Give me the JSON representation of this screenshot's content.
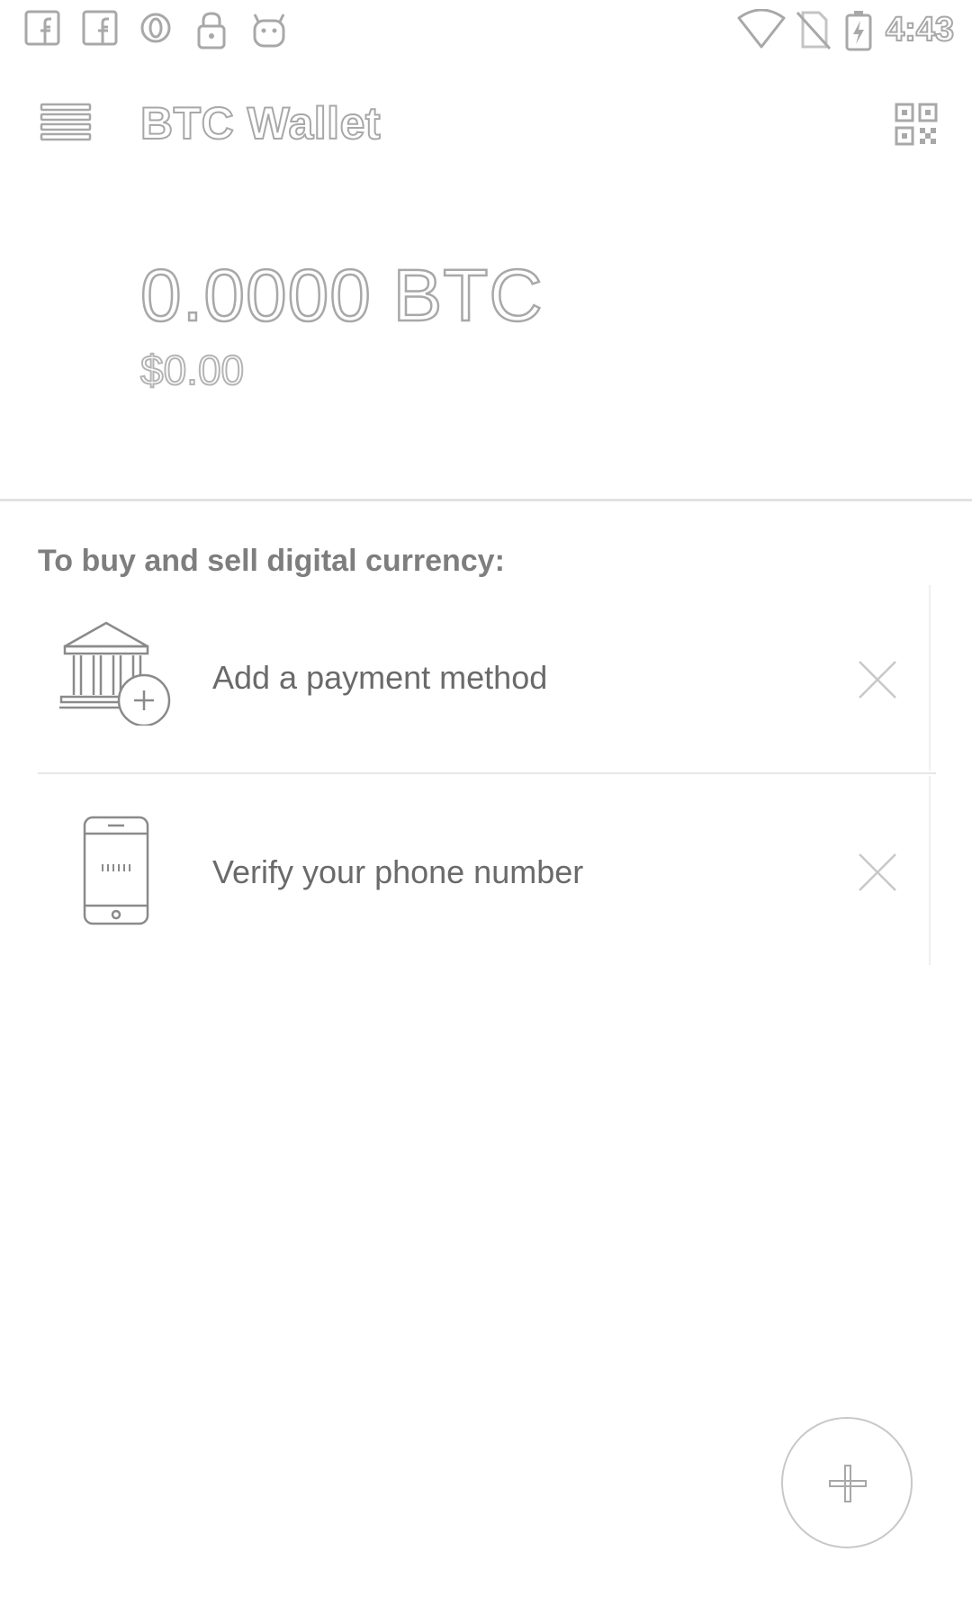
{
  "status_bar": {
    "time": "4:43",
    "icons": [
      "facebook-icon",
      "facebook-icon",
      "opera-icon",
      "lock-icon",
      "android-icon",
      "wifi-icon",
      "no-sim-icon",
      "battery-charging-icon"
    ]
  },
  "app_bar": {
    "title": "BTC Wallet",
    "menu_icon": "hamburger-menu-icon",
    "qr_icon": "qr-code-icon"
  },
  "balance": {
    "amount": "0.0000 BTC",
    "fiat": "$0.00"
  },
  "onboarding": {
    "heading": "To buy and sell digital currency:",
    "cards": [
      {
        "label": "Add a payment method",
        "icon": "bank-add-icon",
        "dismiss_icon": "close-icon"
      },
      {
        "label": "Verify your phone number",
        "icon": "phone-icon",
        "dismiss_icon": "close-icon"
      }
    ]
  },
  "fab": {
    "icon": "plus-icon"
  },
  "colors": {
    "background": "#ffffff",
    "outline_text": "#a8a8a8",
    "body_text": "#6a6a6a",
    "divider": "#e2e2e2"
  }
}
